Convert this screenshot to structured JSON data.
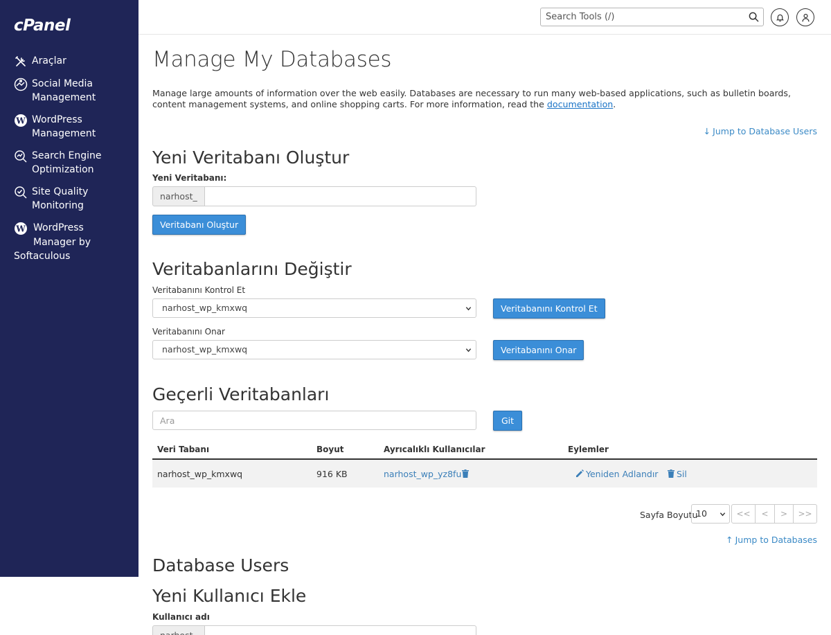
{
  "app": {
    "logo": "cPanel"
  },
  "sidebar": {
    "items": [
      {
        "label": "Araçlar",
        "icon": "tools-icon"
      },
      {
        "label": "Social Media Management",
        "icon": "social-media-icon"
      },
      {
        "label": "WordPress Management",
        "icon": "wordpress-icon"
      },
      {
        "label": "Search Engine Optimization",
        "icon": "seo-icon"
      },
      {
        "label": "Site Quality Monitoring",
        "icon": "site-quality-icon"
      },
      {
        "label_line1": "WordPress",
        "label_line2": "Manager by",
        "label_line3": "Softaculous",
        "icon": "wordpress-icon"
      }
    ]
  },
  "topbar": {
    "search_placeholder": "Search Tools (/)"
  },
  "page": {
    "title": "Manage My Databases",
    "description": "Manage large amounts of information over the web easily. Databases are necessary to run many web-based applications, such as bulletin boards, content management systems, and online shopping carts. For more information, read the ",
    "doc_link": "documentation",
    "description_end": ".",
    "jump_users": "Jump to Database Users",
    "jump_databases": "Jump to Databases"
  },
  "create_db": {
    "heading": "Yeni Veritabanı Oluştur",
    "label": "Yeni Veritabanı:",
    "prefix": "narhost_",
    "value": "",
    "button": "Veritabanı Oluştur"
  },
  "modify_db": {
    "heading": "Veritabanlarını Değiştir",
    "check_label": "Veritabanını Kontrol Et",
    "check_selected": "narhost_wp_kmxwq",
    "check_button": "Veritabanını Kontrol Et",
    "repair_label": "Veritabanını Onar",
    "repair_selected": "narhost_wp_kmxwq",
    "repair_button": "Veritabanını Onar"
  },
  "current_db": {
    "heading": "Geçerli Veritabanları",
    "search_placeholder": "Ara",
    "go_button": "Git",
    "columns": [
      "Veri Tabanı",
      "Boyut",
      "Ayrıcalıklı Kullanıcılar",
      "Eylemler"
    ],
    "rows": [
      {
        "name": "narhost_wp_kmxwq",
        "size": "916 KB",
        "user": "narhost_wp_yz8fu",
        "rename": "Yeniden Adlandır",
        "delete": "Sil"
      }
    ],
    "page_size_label": "Sayfa Boyutu",
    "page_size": "10",
    "pager": [
      "<<",
      "<",
      ">",
      ">>"
    ]
  },
  "db_users": {
    "heading": "Database Users",
    "add_heading": "Yeni Kullanıcı Ekle",
    "username_label": "Kullanıcı adı",
    "prefix": "narhost_"
  },
  "colors": {
    "sidebar": "#1f2557",
    "primary_button": "#3b8ed8",
    "link": "#3b7fb8"
  }
}
